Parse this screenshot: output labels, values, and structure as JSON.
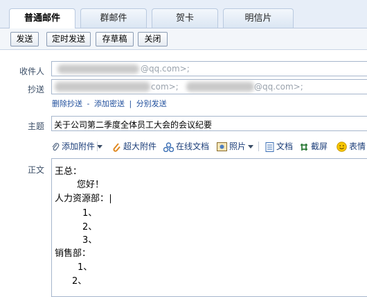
{
  "tabs": [
    {
      "label": "普通邮件",
      "active": true
    },
    {
      "label": "群邮件",
      "active": false
    },
    {
      "label": "贺卡",
      "active": false
    },
    {
      "label": "明信片",
      "active": false
    }
  ],
  "toolbar": {
    "send": "发送",
    "scheduled_send": "定时发送",
    "save_draft": "存草稿",
    "close": "关闭"
  },
  "form": {
    "to_label": "收件人",
    "to_value": "@qq.com>;",
    "cc_label": "抄送",
    "cc_value_1": "com>;",
    "cc_value_2": "@qq.com>;",
    "link_remove_cc": "删除抄送",
    "link_dash": "-",
    "link_add_bcc": "添加密送",
    "link_sep": "|",
    "link_separate_send": "分别发送",
    "subject_label": "主题",
    "subject_value": "关于公司第二季度全体员工大会的会议纪要",
    "body_label": "正文"
  },
  "attach_toolbar": {
    "add_attachment": "添加附件",
    "large_attachment": "超大附件",
    "online_doc": "在线文档",
    "photo": "照片",
    "document": "文档",
    "screenshot": "截屏",
    "emoji": "表情"
  },
  "body_lines": [
    "王总：",
    "您好！",
    "人力资源部：",
    "1、",
    "2、",
    "3、",
    "销售部：",
    "1、",
    "2、"
  ],
  "colors": {
    "link": "#1f4e9c",
    "label": "#3a4d66",
    "border": "#a6b6cc",
    "tabbar_bg": "#e7eef8"
  }
}
